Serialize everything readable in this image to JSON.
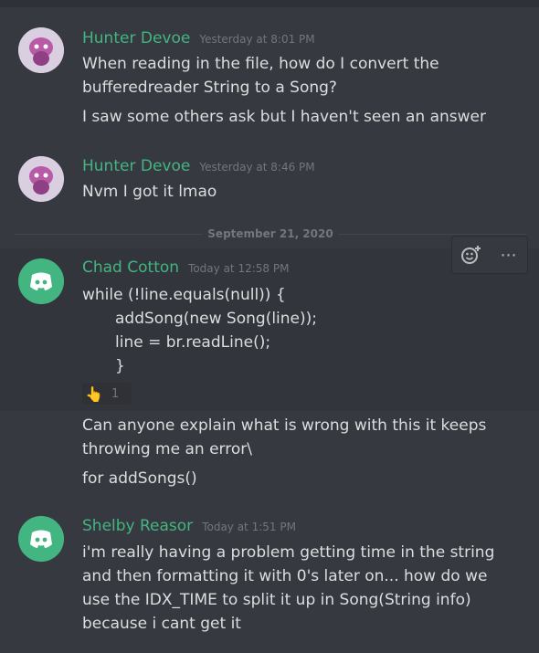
{
  "messages": [
    {
      "author": "Hunter Devoe",
      "timestamp": "Yesterday at 8:01 PM",
      "lines": [
        "When reading in the file, how do I convert the",
        "bufferedreader String to a Song?",
        "I saw some others ask but I haven't seen an answer"
      ]
    },
    {
      "author": "Hunter Devoe",
      "timestamp": "Yesterday at 8:46 PM",
      "lines": [
        "Nvm I got it lmao"
      ]
    },
    {
      "author": "Chad Cotton",
      "timestamp": "Today at 12:58 PM",
      "lines": [
        "while (!line.equals(null)) {",
        "addSong(new Song(line));",
        "line = br.readLine();",
        "}",
        "Can anyone explain what is wrong with this it keeps",
        "throwing me an error\\",
        "for addSongs()"
      ],
      "reaction": {
        "emoji": "👆",
        "count": "1"
      }
    },
    {
      "author": "Shelby Reasor",
      "timestamp": "Today at 1:51 PM",
      "lines": [
        "i'm really having a problem getting time in the string",
        "and then formatting it with 0's later on... how do we",
        "use the IDX_TIME to split it up in Song(String info)",
        "because i cant get it"
      ]
    }
  ],
  "date_divider": "September 21, 2020",
  "toolbar": {
    "react_icon": "add-reaction-icon",
    "more_icon": "more-options-icon",
    "more_label": "⋯"
  },
  "colors": {
    "username": "#43b581",
    "background": "#36393f",
    "text": "#dcddde",
    "timestamp": "#72767d"
  }
}
